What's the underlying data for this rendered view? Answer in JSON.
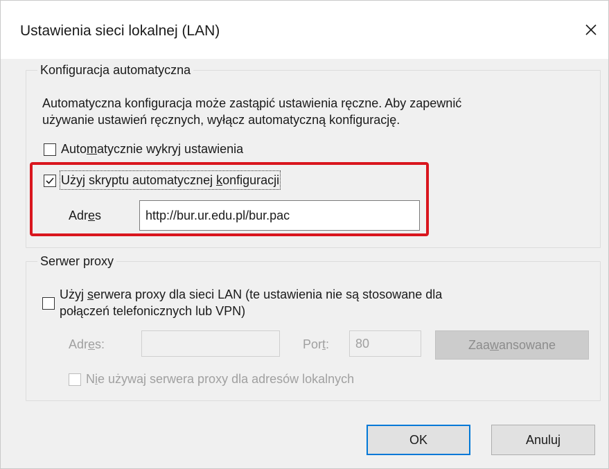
{
  "window": {
    "title": "Ustawienia sieci lokalnej (LAN)",
    "close_icon": "close-icon"
  },
  "auto_config": {
    "legend": "Konfiguracja automatyczna",
    "description_line1": "Automatyczna konfiguracja może zastąpić ustawienia ręczne. Aby zapewnić",
    "description_line2": "używanie ustawień ręcznych, wyłącz automatyczną konfigurację.",
    "auto_detect": {
      "label_pre": "Auto",
      "label_key": "m",
      "label_post": "atycznie wykryj ustawienia",
      "checked": false
    },
    "use_script": {
      "label_pre": "Użyj skryptu automatycznej ",
      "label_key": "k",
      "label_post": "onfiguracji",
      "checked": true
    },
    "address": {
      "label_pre": "Adr",
      "label_key": "e",
      "label_post": "s",
      "value": "http://bur.ur.edu.pl/bur.pac"
    }
  },
  "proxy": {
    "legend": "Serwer proxy",
    "use_proxy": {
      "line1_pre": "Użyj ",
      "line1_key": "s",
      "line1_post": "erwera proxy dla sieci LAN (te ustawienia nie są stosowane dla",
      "line2": "połączeń telefonicznych lub VPN)",
      "checked": false
    },
    "address": {
      "label_pre": "Adr",
      "label_key": "e",
      "label_post": "s:",
      "value": ""
    },
    "port": {
      "label_pre": "Por",
      "label_key": "t",
      "label_post": ":",
      "value": "80"
    },
    "advanced_button": {
      "label_pre": "Zaa",
      "label_key": "w",
      "label_post": "ansowane"
    },
    "bypass_local": {
      "label_pre": "N",
      "label_key": "i",
      "label_post": "e używaj serwera proxy dla adresów lokalnych",
      "checked": false
    }
  },
  "buttons": {
    "ok": "OK",
    "cancel": "Anuluj"
  },
  "colors": {
    "highlight": "#d9161e",
    "default_button_border": "#0078d7",
    "dialog_background": "#f0f0f0"
  }
}
